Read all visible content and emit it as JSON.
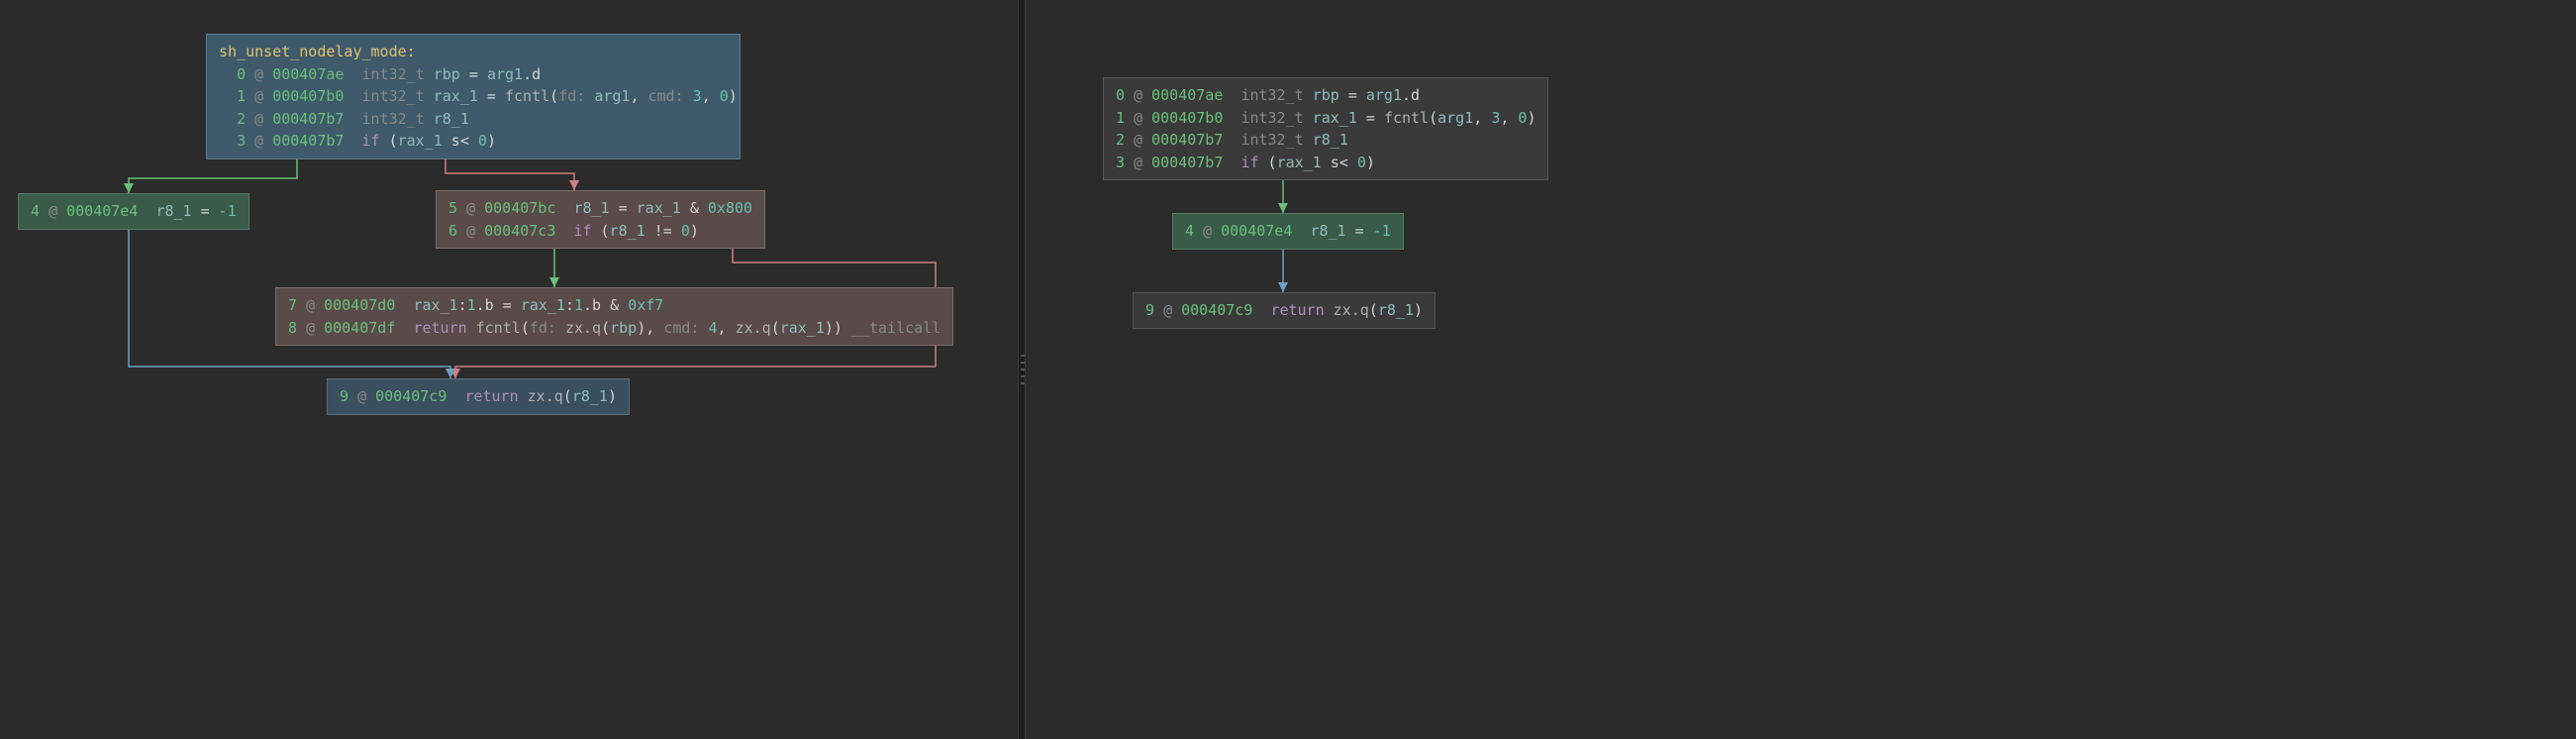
{
  "left": {
    "block0": {
      "title": "sh_unset_nodelay_mode:",
      "lines": [
        {
          "idx": "0",
          "addr": "000407ae",
          "type": "int32_t",
          "var": "rbp",
          "rest": " = ",
          "tail": [
            {
              "t": "var",
              "v": "arg1"
            },
            {
              "t": "op",
              "v": ".d"
            }
          ]
        },
        {
          "idx": "1",
          "addr": "000407b0",
          "type": "int32_t",
          "var": "rax_1",
          "rest": " = ",
          "tail": [
            {
              "t": "call",
              "v": "fcntl"
            },
            {
              "t": "paren",
              "v": "("
            },
            {
              "t": "param",
              "v": "fd: "
            },
            {
              "t": "var",
              "v": "arg1"
            },
            {
              "t": "op",
              "v": ", "
            },
            {
              "t": "param",
              "v": "cmd: "
            },
            {
              "t": "num",
              "v": "3"
            },
            {
              "t": "op",
              "v": ", "
            },
            {
              "t": "num",
              "v": "0"
            },
            {
              "t": "paren",
              "v": ")"
            }
          ]
        },
        {
          "idx": "2",
          "addr": "000407b7",
          "type": "int32_t",
          "var": "r8_1",
          "rest": "",
          "tail": []
        },
        {
          "idx": "3",
          "addr": "000407b7",
          "type": "",
          "var": "",
          "rest": "",
          "tail": [
            {
              "t": "kw",
              "v": "if "
            },
            {
              "t": "paren",
              "v": "("
            },
            {
              "t": "var",
              "v": "rax_1"
            },
            {
              "t": "op",
              "v": " s< "
            },
            {
              "t": "num",
              "v": "0"
            },
            {
              "t": "paren",
              "v": ")"
            }
          ]
        }
      ]
    },
    "block4": {
      "idx": "4",
      "addr": "000407e4",
      "tail": [
        {
          "t": "var",
          "v": "r8_1"
        },
        {
          "t": "op",
          "v": " = "
        },
        {
          "t": "num",
          "v": "-1"
        }
      ]
    },
    "block5": {
      "lines": [
        {
          "idx": "5",
          "addr": "000407bc",
          "tail": [
            {
              "t": "var",
              "v": "r8_1"
            },
            {
              "t": "op",
              "v": " = "
            },
            {
              "t": "var",
              "v": "rax_1"
            },
            {
              "t": "op",
              "v": " & "
            },
            {
              "t": "num",
              "v": "0x800"
            }
          ]
        },
        {
          "idx": "6",
          "addr": "000407c3",
          "tail": [
            {
              "t": "kw",
              "v": "if "
            },
            {
              "t": "paren",
              "v": "("
            },
            {
              "t": "var",
              "v": "r8_1"
            },
            {
              "t": "op",
              "v": " != "
            },
            {
              "t": "num",
              "v": "0"
            },
            {
              "t": "paren",
              "v": ")"
            }
          ]
        }
      ]
    },
    "block7": {
      "lines": [
        {
          "idx": "7",
          "addr": "000407d0",
          "tail": [
            {
              "t": "var",
              "v": "rax_1"
            },
            {
              "t": "op",
              "v": ":"
            },
            {
              "t": "num",
              "v": "1"
            },
            {
              "t": "op",
              "v": ".b = "
            },
            {
              "t": "var",
              "v": "rax_1"
            },
            {
              "t": "op",
              "v": ":"
            },
            {
              "t": "num",
              "v": "1"
            },
            {
              "t": "op",
              "v": ".b & "
            },
            {
              "t": "num",
              "v": "0xf7"
            }
          ]
        },
        {
          "idx": "8",
          "addr": "000407df",
          "tail": [
            {
              "t": "ret",
              "v": "return "
            },
            {
              "t": "call",
              "v": "fcntl"
            },
            {
              "t": "paren",
              "v": "("
            },
            {
              "t": "param",
              "v": "fd: "
            },
            {
              "t": "call",
              "v": "zx.q"
            },
            {
              "t": "paren",
              "v": "("
            },
            {
              "t": "var",
              "v": "rbp"
            },
            {
              "t": "paren",
              "v": ")"
            },
            {
              "t": "op",
              "v": ", "
            },
            {
              "t": "param",
              "v": "cmd: "
            },
            {
              "t": "num",
              "v": "4"
            },
            {
              "t": "op",
              "v": ", "
            },
            {
              "t": "call",
              "v": "zx.q"
            },
            {
              "t": "paren",
              "v": "("
            },
            {
              "t": "var",
              "v": "rax_1"
            },
            {
              "t": "paren",
              "v": "))"
            },
            {
              "t": "op",
              "v": " "
            },
            {
              "t": "type",
              "v": "__tailcall"
            }
          ]
        }
      ]
    },
    "block9": {
      "idx": "9",
      "addr": "000407c9",
      "tail": [
        {
          "t": "ret",
          "v": "return "
        },
        {
          "t": "call",
          "v": "zx.q"
        },
        {
          "t": "paren",
          "v": "("
        },
        {
          "t": "var",
          "v": "r8_1"
        },
        {
          "t": "paren",
          "v": ")"
        }
      ]
    }
  },
  "right": {
    "block0": {
      "lines": [
        {
          "idx": "0",
          "addr": "000407ae",
          "type": "int32_t",
          "var": "rbp",
          "rest": " = ",
          "tail": [
            {
              "t": "var",
              "v": "arg1"
            },
            {
              "t": "op",
              "v": ".d"
            }
          ]
        },
        {
          "idx": "1",
          "addr": "000407b0",
          "type": "int32_t",
          "var": "rax_1",
          "rest": " = ",
          "tail": [
            {
              "t": "call",
              "v": "fcntl"
            },
            {
              "t": "paren",
              "v": "("
            },
            {
              "t": "var",
              "v": "arg1"
            },
            {
              "t": "op",
              "v": ", "
            },
            {
              "t": "num",
              "v": "3"
            },
            {
              "t": "op",
              "v": ", "
            },
            {
              "t": "num",
              "v": "0"
            },
            {
              "t": "paren",
              "v": ")"
            }
          ]
        },
        {
          "idx": "2",
          "addr": "000407b7",
          "type": "int32_t",
          "var": "r8_1",
          "rest": "",
          "tail": []
        },
        {
          "idx": "3",
          "addr": "000407b7",
          "type": "",
          "var": "",
          "rest": "",
          "tail": [
            {
              "t": "kw",
              "v": "if "
            },
            {
              "t": "paren",
              "v": "("
            },
            {
              "t": "var",
              "v": "rax_1"
            },
            {
              "t": "op",
              "v": " s< "
            },
            {
              "t": "num",
              "v": "0"
            },
            {
              "t": "paren",
              "v": ")"
            }
          ]
        }
      ]
    },
    "block4": {
      "idx": "4",
      "addr": "000407e4",
      "tail": [
        {
          "t": "var",
          "v": "r8_1"
        },
        {
          "t": "op",
          "v": " = "
        },
        {
          "t": "num",
          "v": "-1"
        }
      ]
    },
    "block9": {
      "idx": "9",
      "addr": "000407c9",
      "tail": [
        {
          "t": "ret",
          "v": "return "
        },
        {
          "t": "call",
          "v": "zx.q"
        },
        {
          "t": "paren",
          "v": "("
        },
        {
          "t": "var",
          "v": "r8_1"
        },
        {
          "t": "paren",
          "v": ")"
        }
      ]
    }
  }
}
